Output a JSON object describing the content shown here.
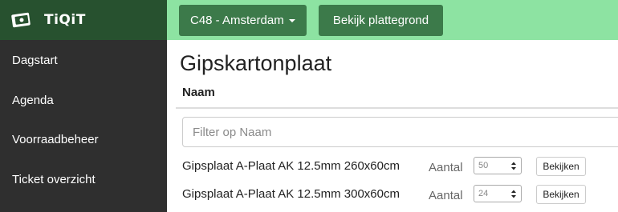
{
  "sidebar": {
    "brand": "TiQiT",
    "items": [
      {
        "label": "Dagstart"
      },
      {
        "label": "Agenda"
      },
      {
        "label": "Voorraadbeheer"
      },
      {
        "label": "Ticket overzicht"
      }
    ]
  },
  "topbar": {
    "location_label": "C48 - Amsterdam",
    "map_button_label": "Bekijk plattegrond"
  },
  "main": {
    "title": "Gipskartonplaat",
    "column_header": "Naam",
    "filter_placeholder": "Filter op Naam",
    "rows": [
      {
        "name": "Gipsplaat A-Plaat AK 12.5mm 260x60cm",
        "qty_label": "Aantal",
        "qty_value": "50",
        "view_label": "Bekijken"
      },
      {
        "name": "Gipsplaat A-Plaat AK 12.5mm 300x60cm",
        "qty_label": "Aantal",
        "qty_value": "24",
        "view_label": "Bekijken"
      }
    ]
  },
  "colors": {
    "sidebar_bg": "#2f2f2f",
    "brand_bg": "#27512f",
    "topbar_bg": "#8de3a2",
    "button_bg": "#3c7a4a"
  },
  "icons": {
    "brand": "ticket-logo-icon",
    "dropdown": "caret-down-icon",
    "spinner": "spinner-arrows-icon"
  }
}
